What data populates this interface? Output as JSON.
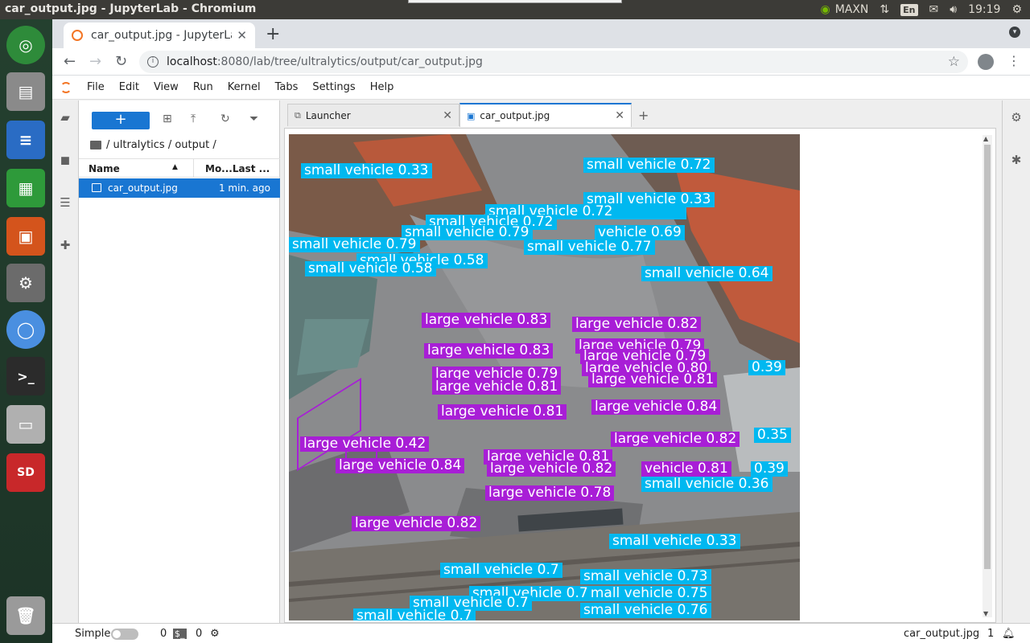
{
  "os": {
    "window_title": "car_output.jpg - JupyterLab - Chromium",
    "tray": {
      "gpu_mode": "MAXN",
      "lang": "En",
      "time": "19:19"
    }
  },
  "browser": {
    "tab_title": "car_output.jpg - JupyterLab",
    "url_host": "localhost",
    "url_path": ":8080/lab/tree/ultralytics/output/car_output.jpg"
  },
  "jupyter": {
    "menu": [
      "File",
      "Edit",
      "View",
      "Run",
      "Kernel",
      "Tabs",
      "Settings",
      "Help"
    ],
    "filebrowser": {
      "new_label": "+",
      "breadcrumb": "/ ultralytics / output /",
      "col_name": "Name",
      "col_modified": "Mo...Last ...",
      "files": [
        {
          "name": "car_output.jpg",
          "modified": "1 min. ago"
        }
      ]
    },
    "tabs": [
      {
        "label": "Launcher"
      },
      {
        "label": "car_output.jpg"
      }
    ],
    "status": {
      "mode_label": "Simple",
      "kernels": "0",
      "terminals": "0",
      "filename": "car_output.jpg",
      "line": "1"
    }
  },
  "detections": {
    "small": [
      "small vehicle 0.33",
      "small vehicle 0.72",
      "small vehicle 0.33",
      "small vehicle 0.72",
      "small vehicle 0.77",
      "vehicle 0.69",
      "small vehicle 0.79",
      "small vehicle 0.58",
      "small vehicle 0.64",
      "small vehicle 0.36",
      "small vehicle 0.33",
      "small vehicle 0.7",
      "small vehicle 0.73",
      "small vehicle 0.75",
      "small vehicle 0.76"
    ],
    "large": [
      "large vehicle 0.83",
      "large vehicle 0.82",
      "large vehicle 0.83",
      "large vehicle 0.79",
      "large vehicle 0.79",
      "large vehicle 0.80",
      "large vehicle 0.81",
      "large vehicle 0.81",
      "large vehicle 0.81",
      "large vehicle 0.84",
      "large vehicle 0.42",
      "large vehicle 0.82",
      "large vehicle 0.84",
      "large vehicle 0.82",
      "vehicle 0.81",
      "large vehicle 0.78",
      "large vehicle 0.82"
    ],
    "edge": [
      "0.39",
      "0.35",
      "0.39"
    ]
  },
  "colors": {
    "small": "#00b8f0",
    "large": "#a81ed6",
    "accent": "#1976d2"
  }
}
